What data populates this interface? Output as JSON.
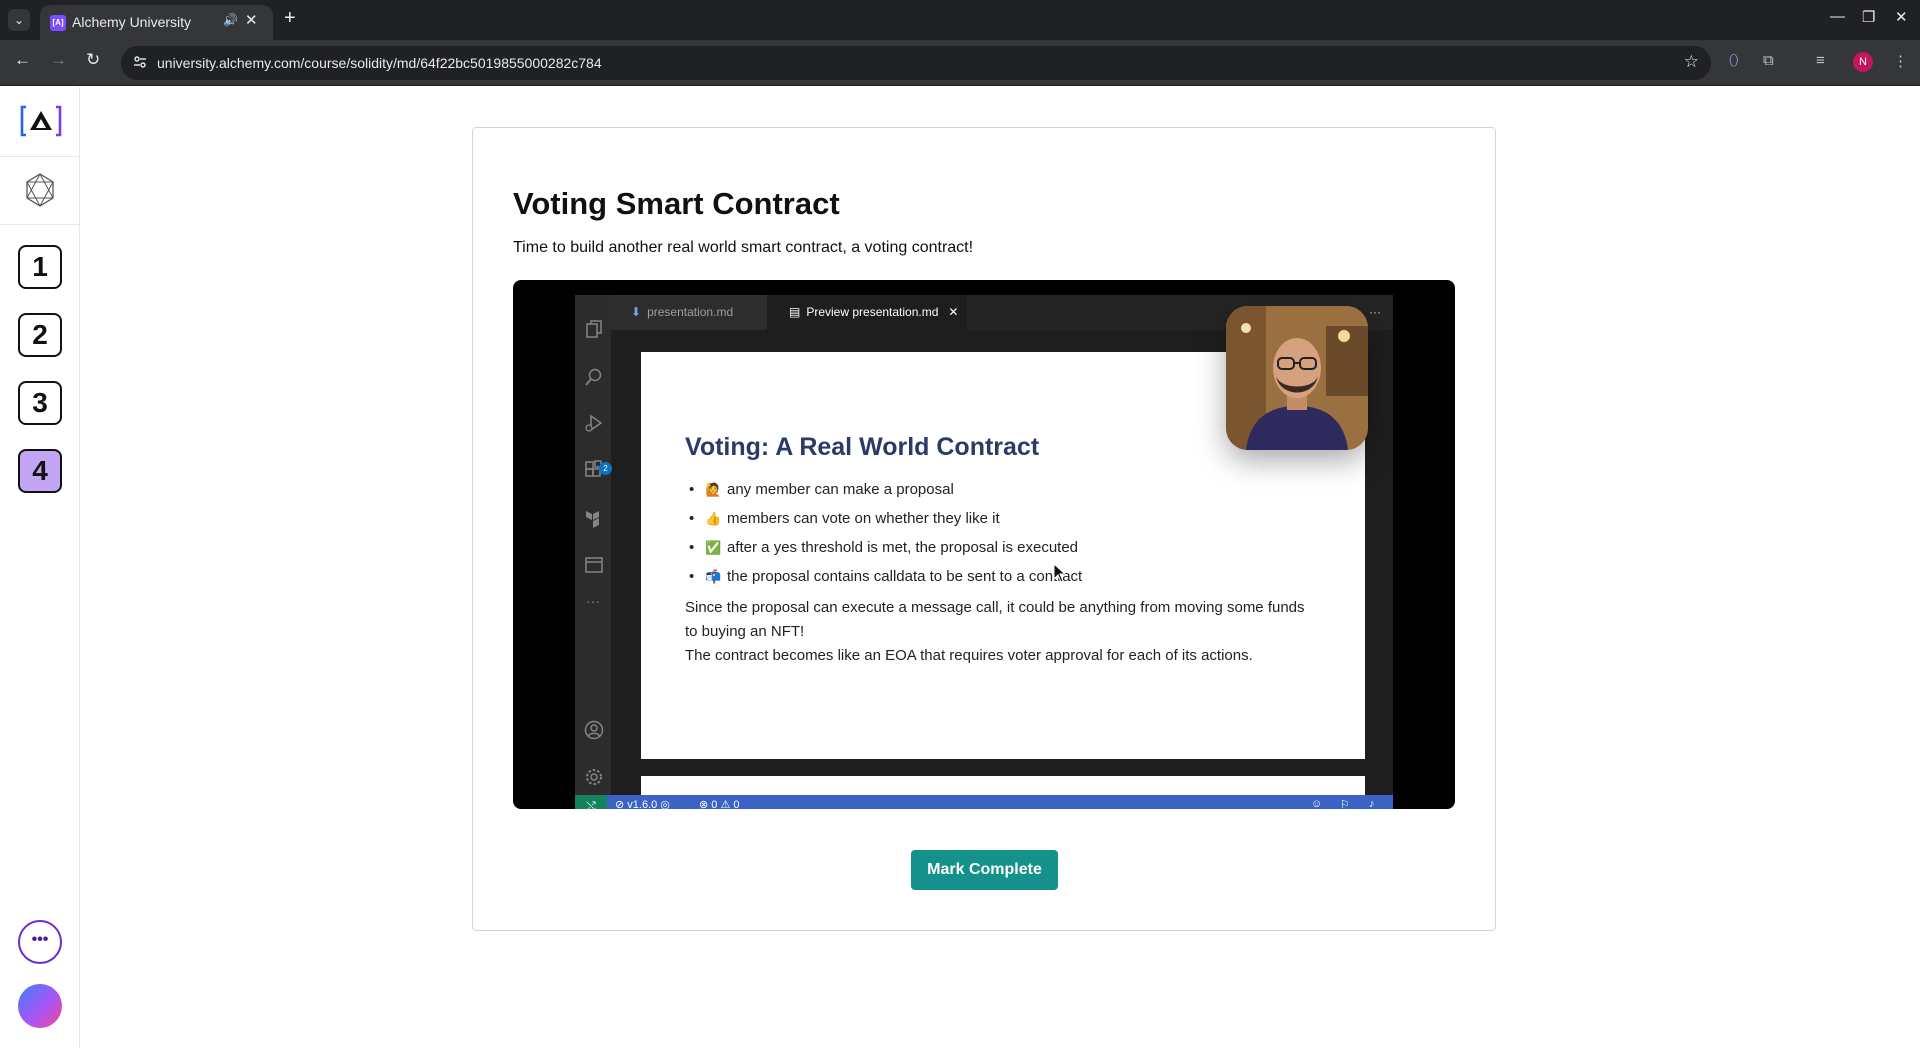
{
  "browser": {
    "tab": {
      "title": "Alchemy University",
      "favicon": "[A]"
    },
    "url": "university.alchemy.com/course/solidity/md/64f22bc5019855000282c784",
    "profile_initial": "N"
  },
  "sidebar": {
    "steps": [
      "1",
      "2",
      "3",
      "4"
    ],
    "active_step": "4",
    "more_label": "•••"
  },
  "lesson": {
    "title": "Voting Smart Contract",
    "subtitle": "Time to build another real world smart contract, a voting contract!"
  },
  "video": {
    "editor_tabs": [
      "presentation.md",
      "Preview presentation.md"
    ],
    "slide": {
      "title": "Voting: A Real World Contract",
      "bullets": [
        {
          "emoji": "🙋",
          "text": "any member can make a proposal"
        },
        {
          "emoji": "👍",
          "text": "members can vote on whether they like it"
        },
        {
          "emoji": "✅",
          "text": "after a yes threshold is met, the proposal is executed"
        },
        {
          "emoji": "📬",
          "text": "the proposal contains calldata to be sent to a contract"
        }
      ],
      "paragraph1": "Since the proposal can execute a message call, it could be anything from moving some funds to buying an NFT!",
      "paragraph2": "The contract becomes like an EOA that requires voter approval for each of its actions."
    },
    "statusbar": {
      "version": "v1.6.0",
      "errors": "0",
      "warnings": "0"
    },
    "extension_badge": "2"
  },
  "actions": {
    "mark_complete": "Mark Complete"
  },
  "colors": {
    "accent": "#14918a",
    "active_step": "#c4a5f5",
    "brand": "#7b4dff"
  }
}
